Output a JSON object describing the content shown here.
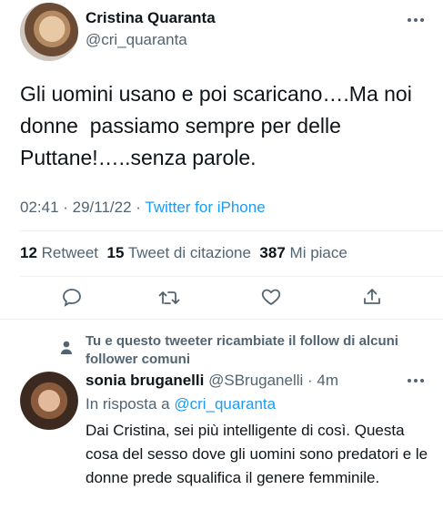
{
  "tweet": {
    "author_name": "Cristina Quaranta",
    "author_handle": "@cri_quaranta",
    "text": "Gli uomini usano e poi scaricano….Ma noi donne  passiamo sempre per delle Puttane!…..senza parole.",
    "time": "02:41 · 29/11/22 · ",
    "source": "Twitter for iPhone",
    "retweet_count": "12",
    "retweet_label": "Retweet",
    "quote_count": "15",
    "quote_label": "Tweet di citazione",
    "like_count": "387",
    "like_label": "Mi piace"
  },
  "actions": {
    "reply": "reply-icon",
    "retweet": "retweet-icon",
    "like": "heart-icon",
    "share": "share-icon"
  },
  "social_context": {
    "text": "Tu e questo tweeter ricambiate il follow di alcuni follower comuni"
  },
  "reply": {
    "author_name": "sonia bruganelli",
    "author_handle": "@SBruganelli",
    "time": "· 4m",
    "in_reply_prefix": "In risposta a ",
    "in_reply_handle": "@cri_quaranta",
    "text": "Dai Cristina, sei più intelligente di così. Questa cosa del sesso dove gli uomini sono predatori e le donne prede squalifica il genere femminile."
  },
  "colors": {
    "accent": "#1d9bf0",
    "secondary_text": "#536471",
    "divider": "#eff3f4"
  }
}
